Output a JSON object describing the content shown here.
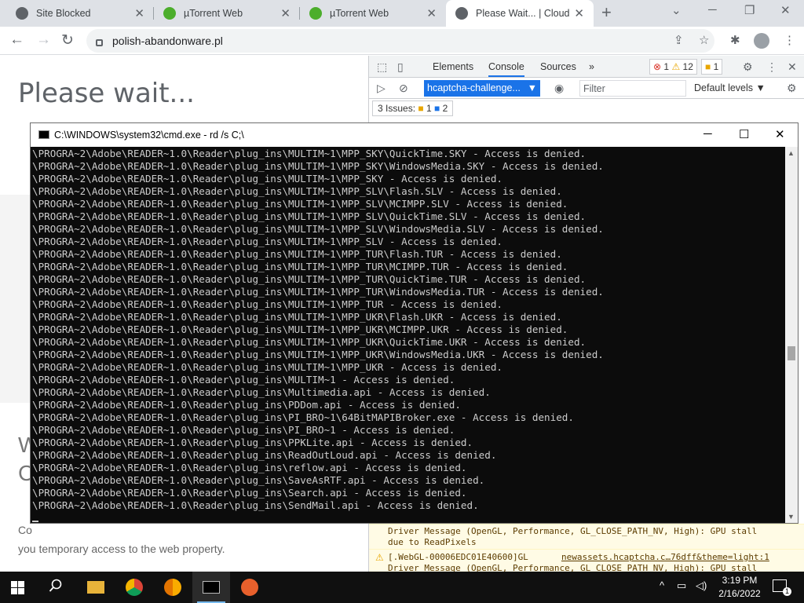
{
  "browser": {
    "tabs": [
      {
        "title": "Site Blocked",
        "favicon": "globe-icon",
        "active": false
      },
      {
        "title": "µTorrent Web",
        "favicon": "utorrent-icon",
        "active": false
      },
      {
        "title": "µTorrent Web",
        "favicon": "utorrent-icon",
        "active": false
      },
      {
        "title": "Please Wait... | Cloudfla",
        "favicon": "globe-icon",
        "active": true
      }
    ],
    "url": "polish-abandonware.pl"
  },
  "page": {
    "heading": "Please wait...",
    "heading2_partial": "W\nC",
    "note": "Co\nyou temporary access to the web property."
  },
  "devtools": {
    "tabs": [
      "Elements",
      "Console",
      "Sources",
      "»"
    ],
    "active_tab": "Console",
    "error_count": "1",
    "warn_count": "12",
    "info_count": "1",
    "context": "hcaptcha-challenge...",
    "filter_placeholder": "Filter",
    "levels": "Default levels ▼",
    "issues_label": "3 Issues:",
    "issues_warn": "1",
    "issues_info": "2",
    "messages": [
      {
        "line1": "Driver Message (OpenGL, Performance, GL_CLOSE_PATH_NV, High): GPU stall",
        "line2": "due to ReadPixels",
        "link": ""
      },
      {
        "line1": "[.WebGL-00006EDC01E40600]GL",
        "line2": "Driver Message (OpenGL, Performance, GL_CLOSE_PATH_NV, High): GPU stall",
        "link": "newassets.hcaptcha.c…76dff&theme=light:1"
      }
    ]
  },
  "cmd": {
    "title": "C:\\WINDOWS\\system32\\cmd.exe - rd  /s C;\\",
    "lines": [
      "\\PROGRA~2\\Adobe\\READER~1.0\\Reader\\plug_ins\\MULTIM~1\\MPP_SKY\\QuickTime.SKY - Access is denied.",
      "\\PROGRA~2\\Adobe\\READER~1.0\\Reader\\plug_ins\\MULTIM~1\\MPP_SKY\\WindowsMedia.SKY - Access is denied.",
      "\\PROGRA~2\\Adobe\\READER~1.0\\Reader\\plug_ins\\MULTIM~1\\MPP_SKY - Access is denied.",
      "\\PROGRA~2\\Adobe\\READER~1.0\\Reader\\plug_ins\\MULTIM~1\\MPP_SLV\\Flash.SLV - Access is denied.",
      "\\PROGRA~2\\Adobe\\READER~1.0\\Reader\\plug_ins\\MULTIM~1\\MPP_SLV\\MCIMPP.SLV - Access is denied.",
      "\\PROGRA~2\\Adobe\\READER~1.0\\Reader\\plug_ins\\MULTIM~1\\MPP_SLV\\QuickTime.SLV - Access is denied.",
      "\\PROGRA~2\\Adobe\\READER~1.0\\Reader\\plug_ins\\MULTIM~1\\MPP_SLV\\WindowsMedia.SLV - Access is denied.",
      "\\PROGRA~2\\Adobe\\READER~1.0\\Reader\\plug_ins\\MULTIM~1\\MPP_SLV - Access is denied.",
      "\\PROGRA~2\\Adobe\\READER~1.0\\Reader\\plug_ins\\MULTIM~1\\MPP_TUR\\Flash.TUR - Access is denied.",
      "\\PROGRA~2\\Adobe\\READER~1.0\\Reader\\plug_ins\\MULTIM~1\\MPP_TUR\\MCIMPP.TUR - Access is denied.",
      "\\PROGRA~2\\Adobe\\READER~1.0\\Reader\\plug_ins\\MULTIM~1\\MPP_TUR\\QuickTime.TUR - Access is denied.",
      "\\PROGRA~2\\Adobe\\READER~1.0\\Reader\\plug_ins\\MULTIM~1\\MPP_TUR\\WindowsMedia.TUR - Access is denied.",
      "\\PROGRA~2\\Adobe\\READER~1.0\\Reader\\plug_ins\\MULTIM~1\\MPP_TUR - Access is denied.",
      "\\PROGRA~2\\Adobe\\READER~1.0\\Reader\\plug_ins\\MULTIM~1\\MPP_UKR\\Flash.UKR - Access is denied.",
      "\\PROGRA~2\\Adobe\\READER~1.0\\Reader\\plug_ins\\MULTIM~1\\MPP_UKR\\MCIMPP.UKR - Access is denied.",
      "\\PROGRA~2\\Adobe\\READER~1.0\\Reader\\plug_ins\\MULTIM~1\\MPP_UKR\\QuickTime.UKR - Access is denied.",
      "\\PROGRA~2\\Adobe\\READER~1.0\\Reader\\plug_ins\\MULTIM~1\\MPP_UKR\\WindowsMedia.UKR - Access is denied.",
      "\\PROGRA~2\\Adobe\\READER~1.0\\Reader\\plug_ins\\MULTIM~1\\MPP_UKR - Access is denied.",
      "\\PROGRA~2\\Adobe\\READER~1.0\\Reader\\plug_ins\\MULTIM~1 - Access is denied.",
      "\\PROGRA~2\\Adobe\\READER~1.0\\Reader\\plug_ins\\Multimedia.api - Access is denied.",
      "\\PROGRA~2\\Adobe\\READER~1.0\\Reader\\plug_ins\\PDDom.api - Access is denied.",
      "\\PROGRA~2\\Adobe\\READER~1.0\\Reader\\plug_ins\\PI_BRO~1\\64BitMAPIBroker.exe - Access is denied.",
      "\\PROGRA~2\\Adobe\\READER~1.0\\Reader\\plug_ins\\PI_BRO~1 - Access is denied.",
      "\\PROGRA~2\\Adobe\\READER~1.0\\Reader\\plug_ins\\PPKLite.api - Access is denied.",
      "\\PROGRA~2\\Adobe\\READER~1.0\\Reader\\plug_ins\\ReadOutLoud.api - Access is denied.",
      "\\PROGRA~2\\Adobe\\READER~1.0\\Reader\\plug_ins\\reflow.api - Access is denied.",
      "\\PROGRA~2\\Adobe\\READER~1.0\\Reader\\plug_ins\\SaveAsRTF.api - Access is denied.",
      "\\PROGRA~2\\Adobe\\READER~1.0\\Reader\\plug_ins\\Search.api - Access is denied.",
      "\\PROGRA~2\\Adobe\\READER~1.0\\Reader\\plug_ins\\SendMail.api - Access is denied."
    ]
  },
  "taskbar": {
    "apps": [
      "file-explorer-icon",
      "chrome-icon",
      "chrome-canary-icon",
      "cmd-icon",
      "app-icon"
    ],
    "time": "3:19 PM",
    "date": "2/16/2022",
    "notification_count": "1"
  },
  "colors": {
    "cmd_bg": "#0c0c0c",
    "cmd_text": "#cccccc",
    "devtools_accent": "#1a73e8",
    "taskbar_bg": "#101010"
  }
}
